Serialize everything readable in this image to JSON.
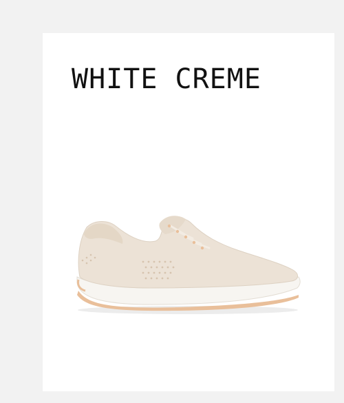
{
  "product": {
    "color_name": "WHITE CREME",
    "image": {
      "icon": "sneaker-icon",
      "colors": {
        "upper": "#ece2d6",
        "sole": "#f7f5f1",
        "accent": "#e9bf9a"
      }
    }
  },
  "colors": {
    "background": "#f2f2f2",
    "card": "#ffffff",
    "text": "#111111"
  }
}
